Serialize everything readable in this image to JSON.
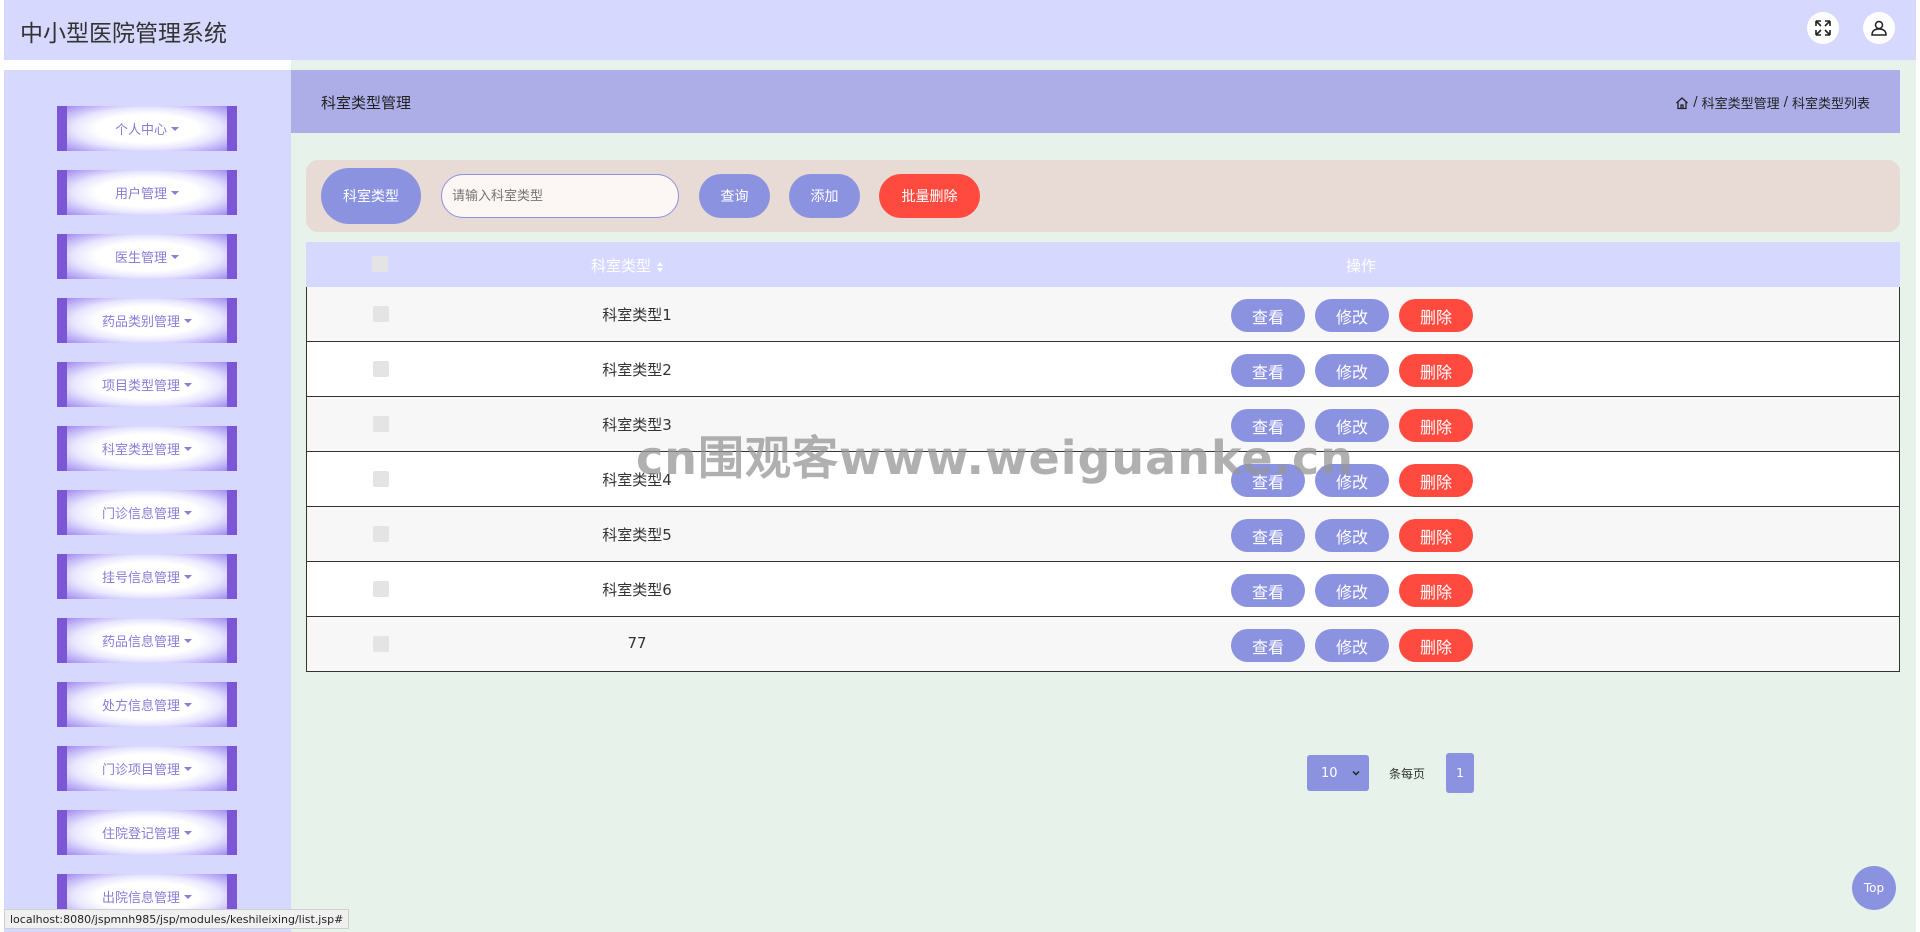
{
  "app": {
    "title": "中小型医院管理系统"
  },
  "header": {
    "fullscreen_icon": "expand-icon",
    "user_icon": "user-icon"
  },
  "sidebar": {
    "items": [
      {
        "label": "个人中心"
      },
      {
        "label": "用户管理"
      },
      {
        "label": "医生管理"
      },
      {
        "label": "药品类别管理"
      },
      {
        "label": "项目类型管理"
      },
      {
        "label": "科室类型管理"
      },
      {
        "label": "门诊信息管理"
      },
      {
        "label": "挂号信息管理"
      },
      {
        "label": "药品信息管理"
      },
      {
        "label": "处方信息管理"
      },
      {
        "label": "门诊项目管理"
      },
      {
        "label": "住院登记管理"
      },
      {
        "label": "出院信息管理"
      }
    ]
  },
  "page": {
    "title": "科室类型管理",
    "breadcrumb": {
      "home_icon": "home-icon",
      "sep": "/",
      "level1": "科室类型管理",
      "level2": "科室类型列表"
    }
  },
  "search": {
    "label": "科室类型",
    "placeholder": "请输入科室类型",
    "query_label": "查询",
    "add_label": "添加",
    "batch_delete_label": "批量删除"
  },
  "table": {
    "columns": {
      "name": "科室类型",
      "actions": "操作"
    },
    "rows": [
      {
        "name": "科室类型1"
      },
      {
        "name": "科室类型2"
      },
      {
        "name": "科室类型3"
      },
      {
        "name": "科室类型4"
      },
      {
        "name": "科室类型5"
      },
      {
        "name": "科室类型6"
      },
      {
        "name": "77"
      }
    ],
    "actions": {
      "view": "查看",
      "edit": "修改",
      "delete": "删除"
    }
  },
  "pagination": {
    "page_size": "10",
    "per_page_label": "条每页",
    "current_page": "1"
  },
  "top_button": "Top",
  "status_bar": "localhost:8080/jspmnh985/jsp/modules/keshileixing/list.jsp#",
  "watermark": "cn围观客www.weiguanke.cn",
  "colors": {
    "primary": "#8b92e0",
    "danger": "#ff4a40",
    "header_bg": "#d6d8fe",
    "sidebar_accent": "#7b57d6",
    "main_bg": "#e6f2ea"
  }
}
